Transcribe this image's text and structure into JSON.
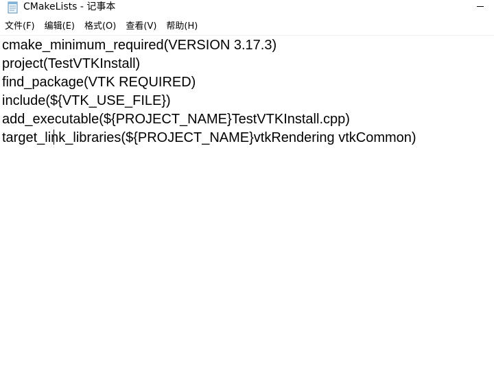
{
  "window": {
    "title": "CMakeLists - 记事本"
  },
  "menu": {
    "items": [
      "文件(F)",
      "编辑(E)",
      "格式(O)",
      "查看(V)",
      "帮助(H)"
    ]
  },
  "editor": {
    "lines": [
      "cmake_minimum_required(VERSION 3.17.3)",
      "project(TestVTKInstall)",
      "find_package(VTK REQUIRED)",
      "include(${VTK_USE_FILE})",
      "add_executable(${PROJECT_NAME}TestVTKInstall.cpp)",
      "target_link_libraries(${PROJECT_NAME}vtkRendering vtkCommon)"
    ]
  },
  "icons": {
    "app": "notepad-icon",
    "minimize": "minimize-icon"
  }
}
